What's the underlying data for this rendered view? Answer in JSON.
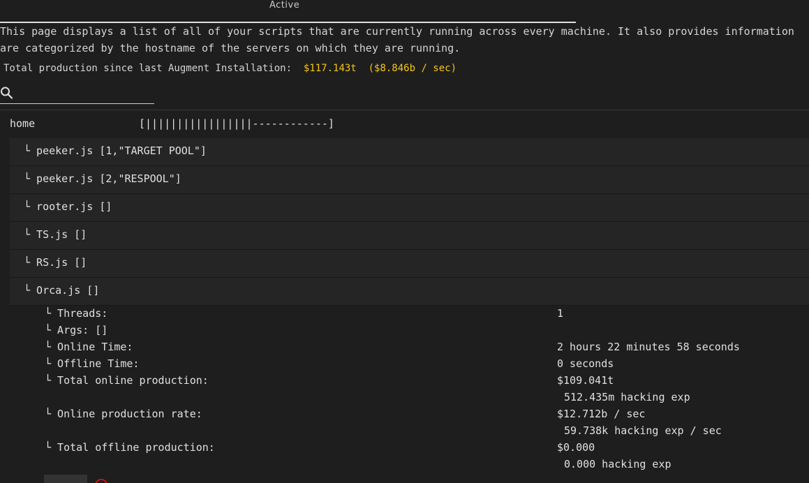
{
  "tab": {
    "active_label": "Active"
  },
  "description": {
    "line1": "This page displays a list of all of your scripts that are currently running across every machine. It also provides information",
    "line2": "are categorized by the hostname of the servers on which they are running."
  },
  "production": {
    "label": "Total production since last Augment Installation:",
    "total": "$117.143t",
    "rate": "($8.846b / sec)"
  },
  "search": {
    "placeholder": "",
    "value": ""
  },
  "server": {
    "hostname": "home",
    "ram_bar": "[|||||||||||||||||------------]"
  },
  "scripts": [
    {
      "label": "└ peeker.js [1,\"TARGET POOL\"]"
    },
    {
      "label": "└ peeker.js [2,\"RESPOOL\"]"
    },
    {
      "label": "└ rooter.js []"
    },
    {
      "label": "└ TS.js []"
    },
    {
      "label": "└ RS.js []"
    },
    {
      "label": "└ Orca.js []"
    }
  ],
  "details": {
    "threads_label": "└ Threads:",
    "threads_value": "1",
    "args_label": "└ Args: []",
    "online_time_label": "└ Online Time:",
    "online_time_value": "2 hours 22 minutes 58 seconds",
    "offline_time_label": "└ Offline Time:",
    "offline_time_value": "0 seconds",
    "total_online_label": "└ Total online production:",
    "total_online_money": "$109.041t",
    "total_online_exp": "512.435m hacking exp",
    "online_rate_label": "└ Online production rate:",
    "online_rate_money": "$12.712b / sec",
    "online_rate_exp": "59.738k hacking exp / sec",
    "total_offline_label": "└ Total offline production:",
    "total_offline_money": "$0.000",
    "total_offline_exp": "0.000 hacking exp"
  },
  "colors": {
    "money": "#f5c518",
    "background": "#1e1e1e",
    "row": "#252525"
  }
}
